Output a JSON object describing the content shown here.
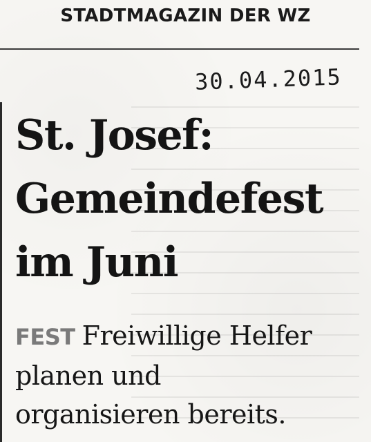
{
  "publication": {
    "masthead": "STADTMAGAZIN DER WZ"
  },
  "stamp": {
    "handwritten_date": "30.04.2015"
  },
  "article": {
    "headline_lines": [
      "St. Josef:",
      "Gemeindefest",
      "im Juni"
    ],
    "kicker": "FEST",
    "subheadline_lines": [
      "Freiwillige Helfer",
      "planen und",
      "organisieren bereits."
    ]
  }
}
